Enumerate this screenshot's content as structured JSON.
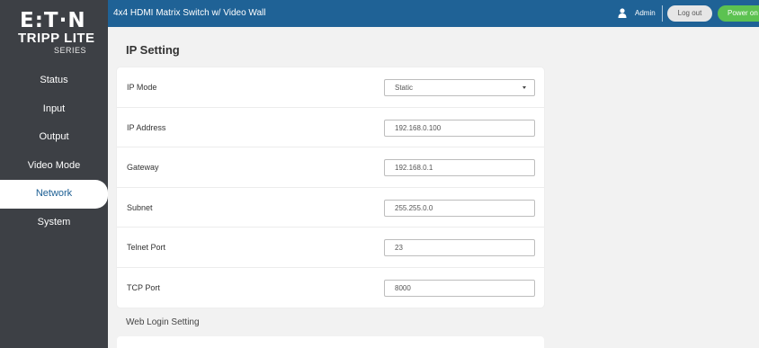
{
  "brand": {
    "logo_top": "E:T·N",
    "logo_mid": "TRIPP LITE",
    "logo_bottom": "SERIES"
  },
  "header": {
    "title": "4x4 HDMI Matrix Switch w/ Video Wall",
    "user": "Admin",
    "logout_label": "Log out",
    "power_label": "Power on",
    "colors": {
      "bar": "#1f6296",
      "power": "#5cc251"
    }
  },
  "sidebar": {
    "items": [
      {
        "label": "Status"
      },
      {
        "label": "Input"
      },
      {
        "label": "Output"
      },
      {
        "label": "Video Mode"
      },
      {
        "label": "Network",
        "active": true
      },
      {
        "label": "System"
      }
    ]
  },
  "main": {
    "title": "IP Setting",
    "fields": [
      {
        "label": "IP Mode",
        "value": "Static",
        "type": "select"
      },
      {
        "label": "IP Address",
        "value": "192.168.0.100"
      },
      {
        "label": "Gateway",
        "value": "192.168.0.1"
      },
      {
        "label": "Subnet",
        "value": "255.255.0.0"
      },
      {
        "label": "Telnet Port",
        "value": "23"
      },
      {
        "label": "TCP Port",
        "value": "8000"
      }
    ],
    "section2_title": "Web Login Setting"
  }
}
